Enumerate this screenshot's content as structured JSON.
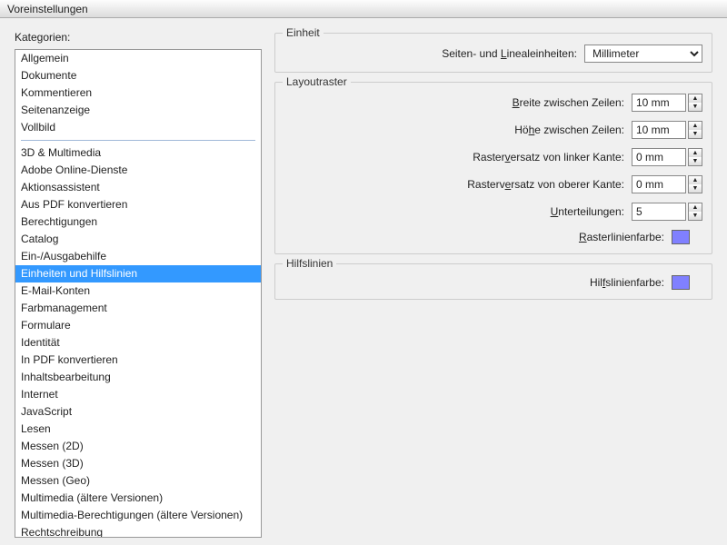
{
  "window": {
    "title": "Voreinstellungen"
  },
  "left": {
    "label": "Kategorien:",
    "groups": [
      [
        "Allgemein",
        "Dokumente",
        "Kommentieren",
        "Seitenanzeige",
        "Vollbild"
      ],
      [
        "3D & Multimedia",
        "Adobe Online-Dienste",
        "Aktionsassistent",
        "Aus PDF konvertieren",
        "Berechtigungen",
        "Catalog",
        "Ein-/Ausgabehilfe",
        "Einheiten und Hilfslinien",
        "E-Mail-Konten",
        "Farbmanagement",
        "Formulare",
        "Identität",
        "In PDF konvertieren",
        "Inhaltsbearbeitung",
        "Internet",
        "JavaScript",
        "Lesen",
        "Messen (2D)",
        "Messen (3D)",
        "Messen (Geo)",
        "Multimedia (ältere Versionen)",
        "Multimedia-Berechtigungen (ältere Versionen)",
        "Rechtschreibung"
      ]
    ],
    "selected": "Einheiten und Hilfslinien"
  },
  "unit": {
    "group_title": "Einheit",
    "page_ruler_label_pre": "Seiten- und ",
    "page_ruler_label_u": "L",
    "page_ruler_label_post": "inealeinheiten:",
    "page_ruler_value": "Millimeter"
  },
  "grid": {
    "group_title": "Layoutraster",
    "width_label_u": "B",
    "width_label_post": "reite zwischen Zeilen:",
    "width_value": "10 mm",
    "height_label_pre": "Hö",
    "height_label_u": "h",
    "height_label_post": "e zwischen Zeilen:",
    "height_value": "10 mm",
    "off_left_label_pre": "Raster",
    "off_left_label_u": "v",
    "off_left_label_post": "ersatz von linker Kante:",
    "off_left_value": "0 mm",
    "off_top_label_pre": "Rasterv",
    "off_top_label_u": "e",
    "off_top_label_post": "rsatz von oberer Kante:",
    "off_top_value": "0 mm",
    "subdiv_label_u": "U",
    "subdiv_label_post": "nterteilungen:",
    "subdiv_value": "5",
    "gridcolor_label_u": "R",
    "gridcolor_label_post": "asterlinienfarbe:",
    "gridcolor_value": "#8080ff"
  },
  "guides": {
    "group_title": "Hilfslinien",
    "color_label_pre": "Hil",
    "color_label_u": "f",
    "color_label_post": "slinienfarbe:",
    "color_value": "#8080ff"
  }
}
